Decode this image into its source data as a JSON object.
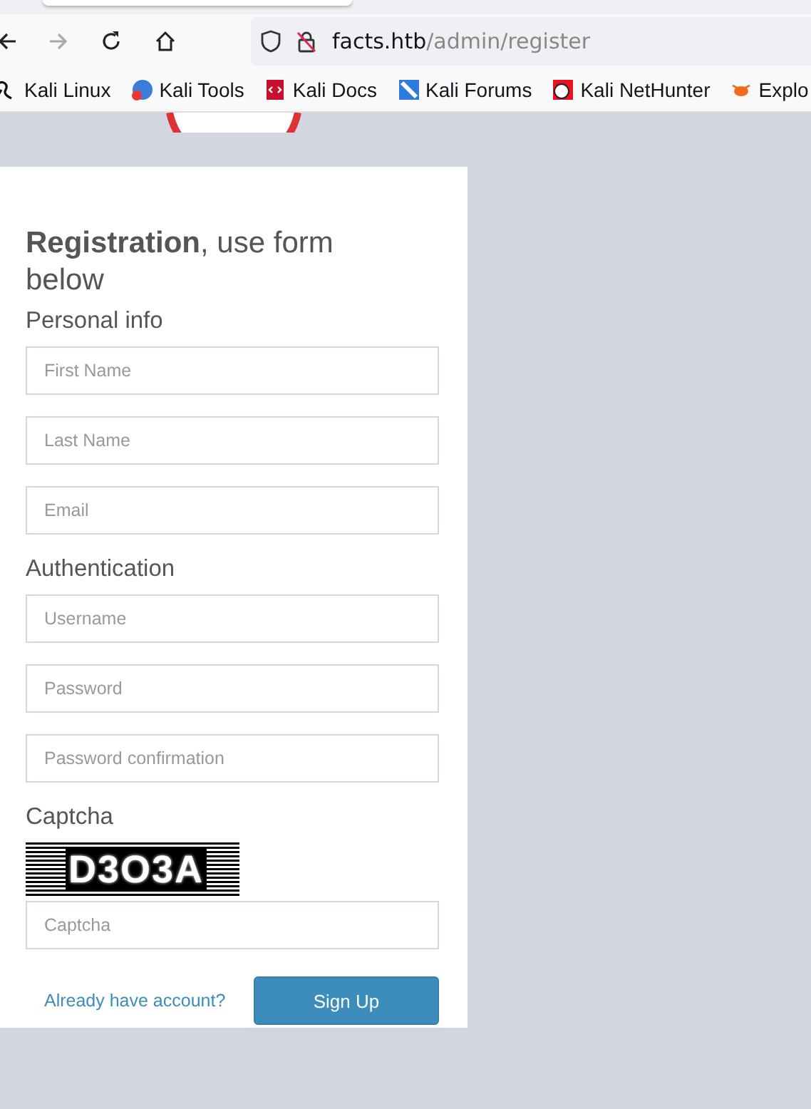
{
  "browser": {
    "url_host": "facts.htb",
    "url_path": "/admin/register",
    "bookmarks": [
      {
        "label": "Kali Linux",
        "kind": "dragon"
      },
      {
        "label": "Kali Tools",
        "kind": "tools"
      },
      {
        "label": "Kali Docs",
        "kind": "docs"
      },
      {
        "label": "Kali Forums",
        "kind": "forums"
      },
      {
        "label": "Kali NetHunter",
        "kind": "nethunter"
      },
      {
        "label": "Explo",
        "kind": "exploit"
      }
    ]
  },
  "form": {
    "title_bold": "Registration",
    "title_rest": ", use form below",
    "sections": [
      {
        "heading": "Personal info",
        "fields": [
          {
            "placeholder": "First Name"
          },
          {
            "placeholder": "Last Name"
          },
          {
            "placeholder": "Email"
          }
        ]
      },
      {
        "heading": "Authentication",
        "fields": [
          {
            "placeholder": "Username"
          },
          {
            "placeholder": "Password"
          },
          {
            "placeholder": "Password confirmation"
          }
        ]
      },
      {
        "heading": "Captcha",
        "captcha": "D3O3A",
        "fields": [
          {
            "placeholder": "Captcha"
          }
        ]
      }
    ],
    "login_link": "Already have account?",
    "submit": "Sign Up"
  }
}
